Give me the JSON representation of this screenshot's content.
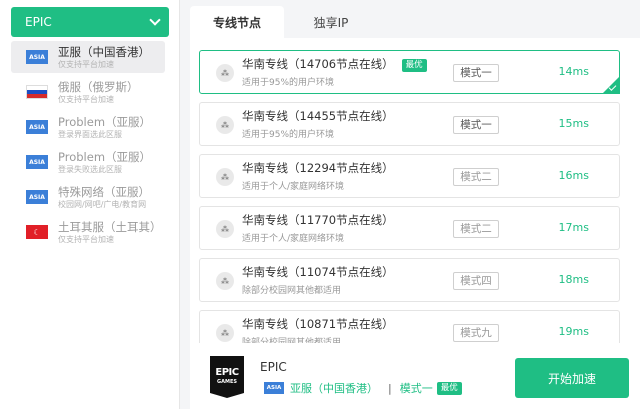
{
  "game_select": {
    "label": "EPIC"
  },
  "regions": [
    {
      "name": "亚服（中国香港）",
      "sub": "仅支持平台加速",
      "flag": "ASIA",
      "active": true
    },
    {
      "name": "俄服（俄罗斯）",
      "sub": "仅支持平台加速",
      "flag": "RU",
      "active": false
    },
    {
      "name": "Problem（亚服）",
      "sub": "登录界面选此区服",
      "flag": "ASIA",
      "active": false
    },
    {
      "name": "Problem（亚服）",
      "sub": "登录失败选此区服",
      "flag": "ASIA",
      "active": false
    },
    {
      "name": "特殊网络（亚服）",
      "sub": "校园网/网吧/广电/教育网",
      "flag": "ASIA",
      "active": false
    },
    {
      "name": "土耳其服（土耳其）",
      "sub": "仅支持平台加速",
      "flag": "TR",
      "active": false
    }
  ],
  "tabs": [
    {
      "label": "专线节点",
      "active": true
    },
    {
      "label": "独享IP",
      "active": false
    }
  ],
  "nodes": [
    {
      "title": "华南专线（14706节点在线）",
      "sub": "适用于95%的用户环境",
      "badge": "最优",
      "mode": "模式一",
      "latency": "14ms",
      "selected": true
    },
    {
      "title": "华南专线（14455节点在线）",
      "sub": "适用于95%的用户环境",
      "badge": "",
      "mode": "模式一",
      "latency": "15ms",
      "selected": false
    },
    {
      "title": "华南专线（12294节点在线）",
      "sub": "适用于个人/家庭网络环境",
      "badge": "",
      "mode": "模式二",
      "latency": "16ms",
      "selected": false
    },
    {
      "title": "华南专线（11770节点在线）",
      "sub": "适用于个人/家庭网络环境",
      "badge": "",
      "mode": "模式二",
      "latency": "17ms",
      "selected": false
    },
    {
      "title": "华南专线（11074节点在线）",
      "sub": "除部分校园网其他都适用",
      "badge": "",
      "mode": "模式四",
      "latency": "18ms",
      "selected": false
    },
    {
      "title": "华南专线（10871节点在线）",
      "sub": "除部分校园网其他都适用",
      "badge": "",
      "mode": "模式九",
      "latency": "19ms",
      "selected": false
    }
  ],
  "bottom": {
    "logo_text": "EPIC",
    "logo_sub": "GAMES",
    "game_name": "EPIC",
    "region_flag": "ASIA",
    "region": "亚服（中国香港）",
    "separator": "|",
    "mode": "模式一",
    "badge": "最优",
    "start_label": "开始加速"
  },
  "colors": {
    "accent": "#1fbe84",
    "asia_flag": "#3b7fd8"
  }
}
